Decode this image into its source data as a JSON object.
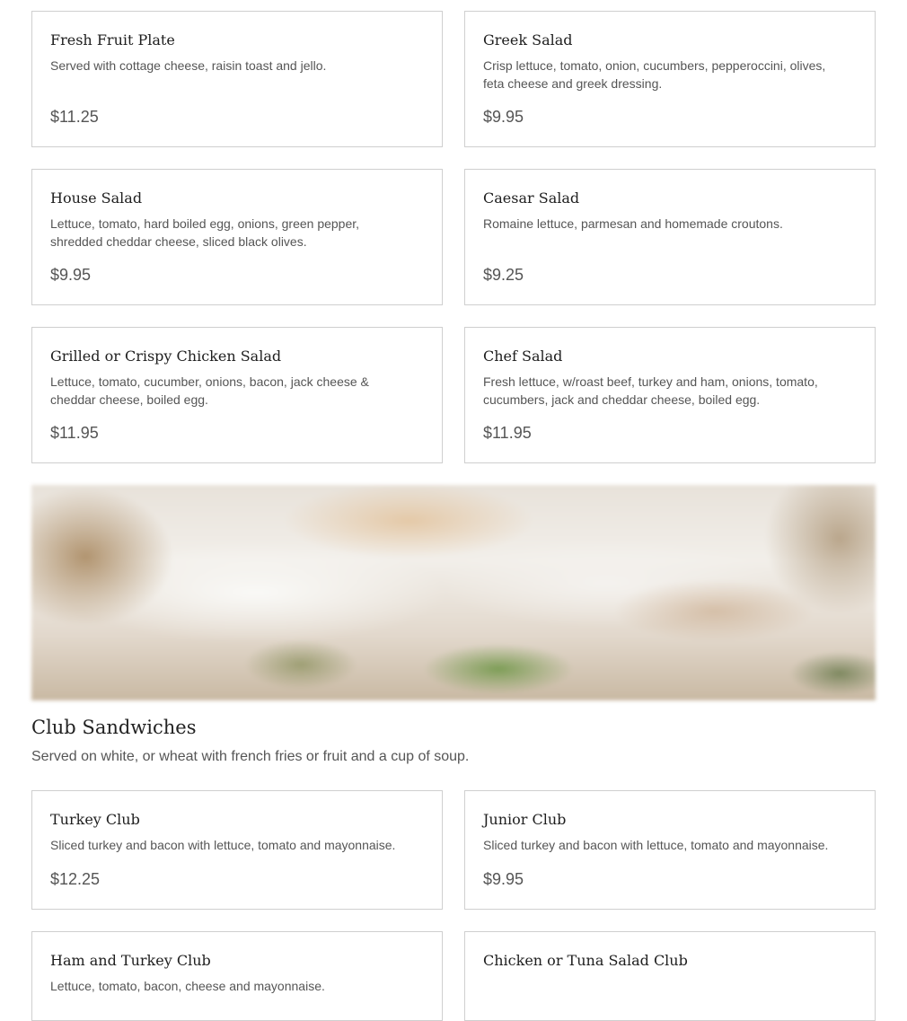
{
  "salads": {
    "items": [
      {
        "name": "Fresh Fruit Plate",
        "description": "Served with cottage cheese, raisin toast and jello.",
        "price": "$11.25"
      },
      {
        "name": "Greek Salad",
        "description": "Crisp lettuce, tomato, onion, cucumbers, pepperoccini, olives, feta cheese and greek dressing.",
        "price": "$9.95"
      },
      {
        "name": "House Salad",
        "description": "Lettuce, tomato, hard boiled egg, onions, green pepper, shredded cheddar cheese, sliced black olives.",
        "price": "$9.95"
      },
      {
        "name": "Caesar Salad",
        "description": "Romaine lettuce, parmesan and homemade croutons.",
        "price": "$9.25"
      },
      {
        "name": "Grilled or Crispy Chicken Salad",
        "description": "Lettuce, tomato, cucumber, onions, bacon, jack cheese & cheddar cheese, boiled egg.",
        "price": "$11.95"
      },
      {
        "name": "Chef Salad",
        "description": "Fresh lettuce, w/roast beef, turkey and ham, onions, tomato, cucumbers, jack and cheddar cheese, boiled egg.",
        "price": "$11.95"
      }
    ]
  },
  "club_sandwiches": {
    "title": "Club Sandwiches",
    "description": "Served on white, or wheat with french fries or fruit and a cup of soup.",
    "items": [
      {
        "name": "Turkey Club",
        "description": "Sliced turkey and bacon with lettuce, tomato and mayonnaise.",
        "price": "$12.25"
      },
      {
        "name": "Junior Club",
        "description": "Sliced turkey and bacon with lettuce, tomato and mayonnaise.",
        "price": "$9.95"
      },
      {
        "name": "Ham and Turkey Club",
        "description": "Lettuce, tomato, bacon, cheese and mayonnaise."
      },
      {
        "name": "Chicken or Tuna Salad Club"
      }
    ]
  },
  "banner_image": {
    "icon": "club-sandwich-photo"
  },
  "colors": {
    "card_border": "#cfcfcf",
    "text_heading": "#1e1e1e",
    "text_body": "#555555"
  }
}
